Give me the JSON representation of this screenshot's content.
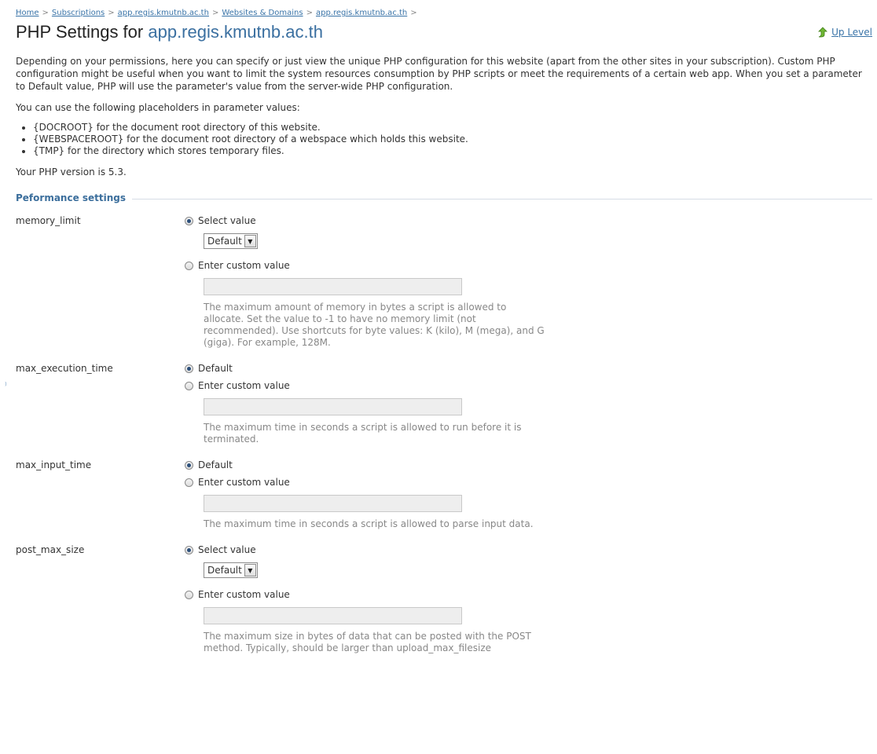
{
  "breadcrumb": {
    "items": [
      "Home",
      "Subscriptions",
      "app.regis.kmutnb.ac.th",
      "Websites & Domains",
      "app.regis.kmutnb.ac.th"
    ],
    "separator": ">"
  },
  "header": {
    "title_prefix": "PHP Settings for",
    "site": "app.regis.kmutnb.ac.th",
    "up_level": "Up Level"
  },
  "intro": {
    "description": "Depending on your permissions, here you can specify or just view the unique PHP configuration for this website (apart from the other sites in your subscription). Custom PHP configuration might be useful when you want to limit the system resources consumption by PHP scripts or meet the requirements of a certain web app. When you set a parameter to Default value, PHP will use the parameter's value from the server-wide PHP configuration.",
    "placeholders_intro": "You can use the following placeholders in parameter values:",
    "placeholders": [
      "{DOCROOT} for the document root directory of this website.",
      "{WEBSPACEROOT} for the document root directory of a webspace which holds this website.",
      "{TMP} for the directory which stores temporary files."
    ],
    "php_version": "Your PHP version is 5.3."
  },
  "section": {
    "title": "Peformance settings"
  },
  "settings": {
    "memory_limit": {
      "name": "memory_limit",
      "option_select": "Select value",
      "select_value": "Default",
      "option_custom": "Enter custom value",
      "custom_value": "",
      "hint": "The maximum amount of memory in bytes a script is allowed to allocate. Set the value to -1 to have no memory limit (not recommended). Use shortcuts for byte values: K (kilo), M (mega), and G (giga). For example, 128M."
    },
    "max_execution_time": {
      "name": "max_execution_time",
      "option_default": "Default",
      "option_custom": "Enter custom value",
      "custom_value": "",
      "hint": "The maximum time in seconds a script is allowed to run before it is terminated."
    },
    "max_input_time": {
      "name": "max_input_time",
      "option_default": "Default",
      "option_custom": "Enter custom value",
      "custom_value": "",
      "hint": "The maximum time in seconds a script is allowed to parse input data."
    },
    "post_max_size": {
      "name": "post_max_size",
      "option_select": "Select value",
      "select_value": "Default",
      "option_custom": "Enter custom value",
      "custom_value": "",
      "hint": "The maximum size in bytes of data that can be posted with the POST method. Typically, should be larger than upload_max_filesize"
    }
  },
  "colors": {
    "link": "#3a74a8",
    "site_title": "#3a6fa0",
    "section_title": "#3b6e9c",
    "hint_text": "#888888",
    "disabled_input": "#eeeeee"
  },
  "icons": {
    "up_level": "green-up-arrow-icon",
    "select_arrow": "chevron-down-icon"
  }
}
